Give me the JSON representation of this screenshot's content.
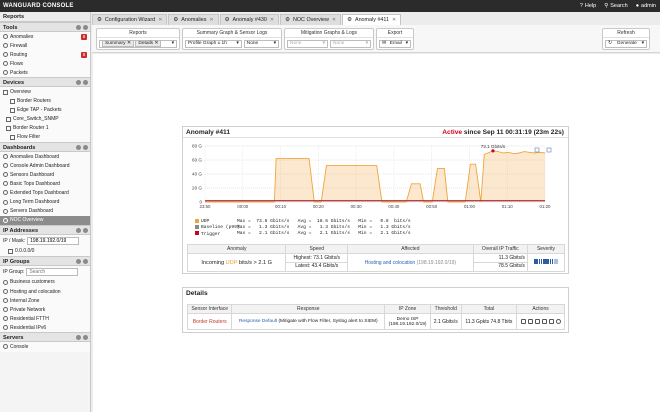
{
  "app": {
    "title": "WANGUARD CONSOLE",
    "help": "Help",
    "search": "Search",
    "user": "admin"
  },
  "sidebar": {
    "reports_title": "Reports",
    "tools": {
      "title": "Tools",
      "items": [
        {
          "label": "Anomalies",
          "badge": "5"
        },
        {
          "label": "Firewall",
          "badge": ""
        },
        {
          "label": "Routing",
          "badge": "5"
        },
        {
          "label": "Flows",
          "badge": ""
        },
        {
          "label": "Packets",
          "badge": ""
        }
      ]
    },
    "devices": {
      "title": "Devices",
      "items": [
        {
          "label": "Overview"
        },
        {
          "label": "Border Routers"
        },
        {
          "label": "Edge TAP - Packets"
        },
        {
          "label": "Core_Switch_SNMP"
        },
        {
          "label": "Border Router 1"
        },
        {
          "label": "Flow Filter"
        }
      ]
    },
    "dashboards": {
      "title": "Dashboards",
      "items": [
        {
          "label": "Anomalies Dashboard"
        },
        {
          "label": "Console Admin Dashboard"
        },
        {
          "label": "Sensors Dashboard"
        },
        {
          "label": "Basic Tops Dashboard"
        },
        {
          "label": "Extended Tops Dashboard"
        },
        {
          "label": "Long Term Dashboard"
        },
        {
          "label": "Servers Dashboard"
        },
        {
          "label": "NOC Overview"
        }
      ]
    },
    "ip_addresses": {
      "title": "IP Addresses",
      "mask_label": "IP / Mask:",
      "mask_value": "198.19.192.0/19",
      "tree_item": "0.0.0.0/0"
    },
    "ip_groups": {
      "title": "IP Groups",
      "group_label": "IP Group:",
      "search_placeholder": "Search",
      "items": [
        {
          "label": "Business customers"
        },
        {
          "label": "Hosting and colocation"
        },
        {
          "label": "Internal Zone"
        },
        {
          "label": "Private Network"
        },
        {
          "label": "Residential FTTH"
        },
        {
          "label": "Residential IPv6"
        }
      ]
    },
    "servers": {
      "title": "Servers",
      "items": [
        {
          "label": "Console"
        }
      ]
    }
  },
  "tabs": [
    {
      "label": "Configuration Wizard"
    },
    {
      "label": "Anomalies"
    },
    {
      "label": "Anomaly #430"
    },
    {
      "label": "NOC Overview"
    },
    {
      "label": "Anomaly #411"
    }
  ],
  "toolbar": {
    "reports": {
      "title": "Reports",
      "chips": [
        "Summary",
        "Details"
      ]
    },
    "summary": {
      "title": "Summary Graph & Sensor Logs",
      "select1": "Profile Graph ± 1h",
      "select2": "None"
    },
    "mitigation": {
      "title": "Mitigation Graphs & Logs",
      "select1": "None",
      "select2": "None"
    },
    "export": {
      "title": "Export",
      "select": "Email"
    },
    "refresh": {
      "title": "Refresh",
      "select": "Generate"
    }
  },
  "anomaly": {
    "title": "Anomaly #411",
    "status_active": "Active",
    "status_since": "since Sep 11 00:31:19 (23m 22s)",
    "peak_label": "73.1 Gbits/s",
    "chart_data": {
      "type": "area",
      "ylabels": [
        "80 G",
        "60 G",
        "40 G",
        "20 G",
        "0"
      ],
      "ylim": [
        0,
        80
      ],
      "xlabels": [
        "23:50",
        "00:00",
        "00:10",
        "00:20",
        "00:30",
        "00:40",
        "00:50",
        "01:00",
        "01:10",
        "01:20"
      ],
      "series": [
        {
          "name": "UDP",
          "color": "#f0a43c",
          "x": [
            0,
            80,
            82,
            120,
            126,
            134,
            140,
            198,
            204,
            232,
            238,
            248,
            252,
            262,
            268,
            276,
            280,
            300,
            306,
            312,
            318,
            322,
            326,
            332,
            338,
            344,
            350,
            356,
            362,
            368,
            374,
            380,
            386,
            392
          ],
          "y": [
            0,
            0,
            62,
            62,
            0,
            0,
            52,
            52,
            0,
            0,
            26,
            26,
            0,
            0,
            48,
            48,
            0,
            0,
            54,
            54,
            0,
            68,
            70,
            73.1,
            72,
            70,
            71,
            69,
            70,
            72,
            71,
            70,
            71,
            70
          ]
        },
        {
          "name": "Baseline (p99)",
          "color": "#8a8a8a",
          "x": [
            0,
            392
          ],
          "y": [
            1.3,
            1.3
          ]
        },
        {
          "name": "Trigger",
          "color": "#d0021b",
          "x": [
            0,
            392
          ],
          "y": [
            2.1,
            2.1
          ]
        }
      ]
    },
    "legend": [
      {
        "name": "UDP",
        "stats": "Max =  73.6 Gbits/s   Avg =  18.5 Gbits/s   Min =   0.8  bits/s",
        "color": "#f0a43c"
      },
      {
        "name": "Baseline (p99)",
        "stats": "Max =   1.3 Gbits/s   Avg =   1.3 Gbits/s   Min =   1.3 Gbits/s",
        "color": "#8a8a8a"
      },
      {
        "name": "Trigger",
        "stats": "Max =   2.1 Gbits/s   Avg =   2.1 Gbits/s   Min =   2.1 Gbits/s",
        "color": "#d0021b"
      }
    ],
    "table": {
      "headers": [
        "Anomaly",
        "Speed",
        "Affected",
        "Overall IP Traffic",
        "Severity"
      ],
      "anomaly_pre": "Incoming",
      "anomaly_key": "UDP",
      "anomaly_post": "bits/s > 2.1 G",
      "speed_highest": "Highest: 73.1 Gbits/s",
      "speed_latest": "Latest: 43.4 Gbits/s",
      "affected": "Hosting and colocation",
      "affected_ip": "(198.19.192.0/19)",
      "traffic_1": "11.3 Gbits/s",
      "traffic_2": "78.5 Gbits/s"
    }
  },
  "details": {
    "title": "Details",
    "headers": [
      "Sensor Interface",
      "Response",
      "IP Zone",
      "Threshold",
      "Total",
      "Actions"
    ],
    "row": {
      "sensor": "Border Routers",
      "response_main": "Response Default",
      "response_detail": "(Mitigate with Flow Filter, Syslog alert to SIEM)",
      "zone": "Demo ISP",
      "zone_ip": "(198.19.192.0/19)",
      "threshold": "2.1 Gbits/s",
      "total": "11.3 Gpkts 74.8 Tbits"
    }
  }
}
